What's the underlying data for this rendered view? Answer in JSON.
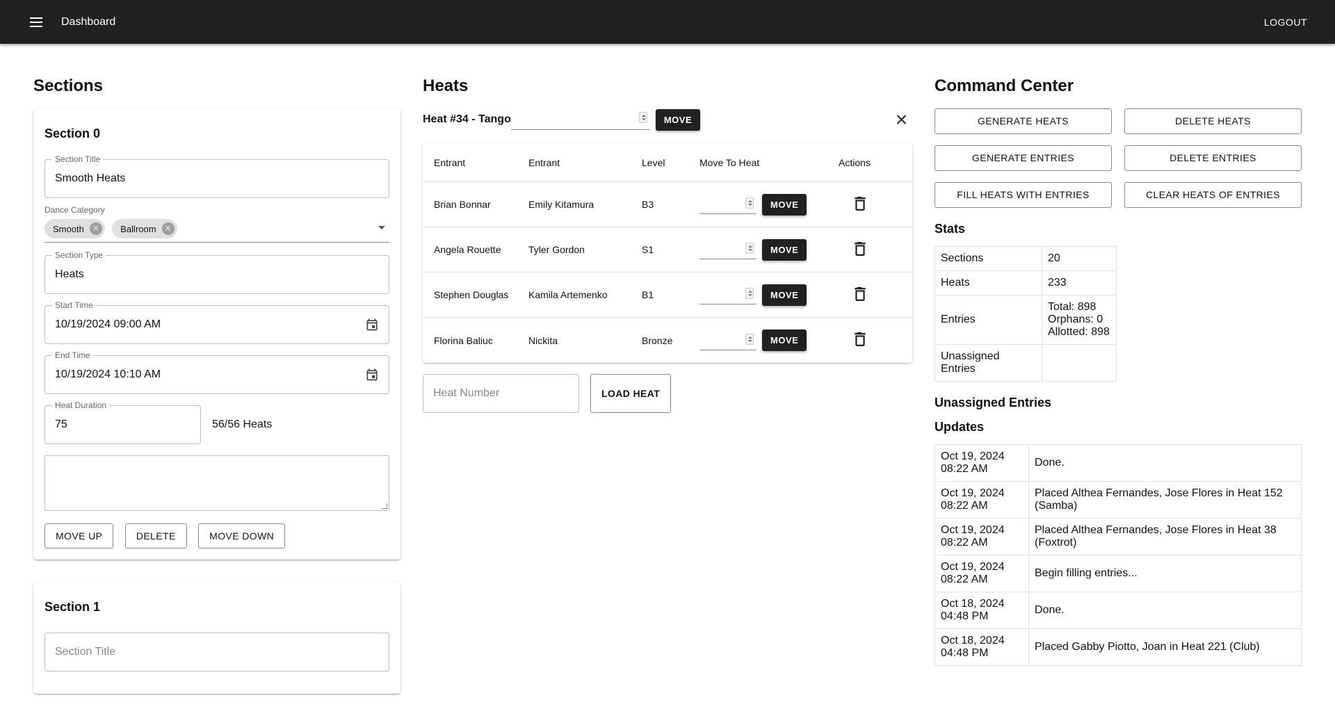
{
  "appbar": {
    "title": "Dashboard",
    "logout": "LOGOUT"
  },
  "sections": {
    "title": "Sections",
    "cards": [
      {
        "heading": "Section 0",
        "title_label": "Section Title",
        "title_value": "Smooth Heats",
        "category_label": "Dance Category",
        "chips": [
          "Smooth",
          "Ballroom"
        ],
        "type_label": "Section Type",
        "type_value": "Heats",
        "start_label": "Start Time",
        "start_value": "10/19/2024 09:00 AM",
        "end_label": "End Time",
        "end_value": "10/19/2024 10:10 AM",
        "duration_label": "Heat Duration",
        "duration_value": "75",
        "heats_count": "56/56 Heats",
        "buttons": {
          "up": "MOVE UP",
          "delete": "DELETE",
          "down": "MOVE DOWN"
        }
      },
      {
        "heading": "Section 1",
        "title_placeholder": "Section Title"
      }
    ]
  },
  "heats": {
    "title": "Heats",
    "current_heat": "Heat #34 - Tango",
    "move_label": "MOVE",
    "columns": [
      "Entrant",
      "Entrant",
      "Level",
      "Move To Heat",
      "Actions"
    ],
    "rows": [
      {
        "e1": "Brian Bonnar",
        "e2": "Emily Kitamura",
        "level": "B3"
      },
      {
        "e1": "Angela Rouette",
        "e2": "Tyler Gordon",
        "level": "S1"
      },
      {
        "e1": "Stephen Douglas",
        "e2": "Kamila Artemenko",
        "level": "B1"
      },
      {
        "e1": "Florina Baliuc",
        "e2": "Nickita",
        "level": "Bronze"
      }
    ],
    "heat_number_placeholder": "Heat Number",
    "load_label": "LOAD HEAT"
  },
  "command_center": {
    "title": "Command Center",
    "buttons": [
      "GENERATE HEATS",
      "DELETE HEATS",
      "GENERATE ENTRIES",
      "DELETE ENTRIES",
      "FILL HEATS WITH ENTRIES",
      "CLEAR HEATS OF ENTRIES"
    ],
    "stats_title": "Stats",
    "stats": {
      "sections_k": "Sections",
      "sections_v": "20",
      "heats_k": "Heats",
      "heats_v": "233",
      "entries_k": "Entries",
      "entries_total": "Total: 898",
      "entries_orphans": "Orphans: 0",
      "entries_allotted": "Allotted: 898",
      "unassigned_k": "Unassigned Entries",
      "unassigned_v": ""
    },
    "unassigned_title": "Unassigned Entries",
    "updates_title": "Updates",
    "updates": [
      {
        "date": "Oct 19, 2024",
        "time": "08:22 AM",
        "msg": "Done."
      },
      {
        "date": "Oct 19, 2024",
        "time": "08:22 AM",
        "msg": "Placed Althea Fernandes, Jose Flores in Heat 152 (Samba)"
      },
      {
        "date": "Oct 19, 2024",
        "time": "08:22 AM",
        "msg": "Placed Althea Fernandes, Jose Flores in Heat 38 (Foxtrot)"
      },
      {
        "date": "Oct 19, 2024",
        "time": "08:22 AM",
        "msg": "Begin filling entries..."
      },
      {
        "date": "Oct 18, 2024",
        "time": "04:48 PM",
        "msg": "Done."
      },
      {
        "date": "Oct 18, 2024",
        "time": "04:48 PM",
        "msg": "Placed Gabby Piotto, Joan in Heat 221 (Club)"
      }
    ]
  }
}
